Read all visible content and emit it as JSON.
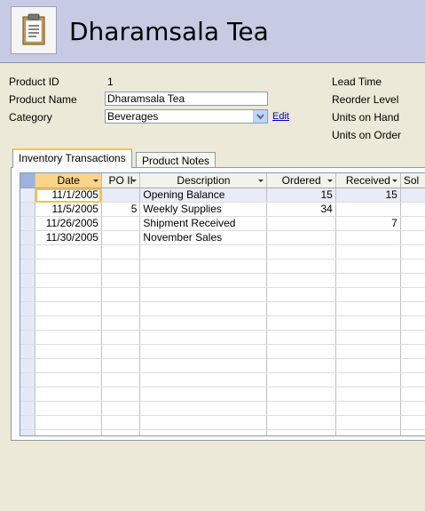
{
  "header": {
    "title": "Dharamsala Tea",
    "icon": "clipboard-icon"
  },
  "fields": {
    "product_id_label": "Product ID",
    "product_id_value": "1",
    "product_name_label": "Product Name",
    "product_name_value": "Dharamsala Tea",
    "category_label": "Category",
    "category_value": "Beverages",
    "edit_link": "Edit",
    "lead_time_label": "Lead Time",
    "reorder_level_label": "Reorder Level",
    "units_on_hand_label": "Units on Hand",
    "units_on_order_label": "Units on Order"
  },
  "tabs": [
    {
      "label": "Inventory Transactions",
      "active": true
    },
    {
      "label": "Product Notes",
      "active": false
    }
  ],
  "grid": {
    "columns": [
      "Date",
      "PO II",
      "Description",
      "Ordered",
      "Received",
      "Sol"
    ],
    "rows": [
      {
        "date": "11/1/2005",
        "po": "",
        "description": "Opening Balance",
        "ordered": "15",
        "received": "15"
      },
      {
        "date": "11/5/2005",
        "po": "5",
        "description": "Weekly Supplies",
        "ordered": "34",
        "received": ""
      },
      {
        "date": "11/26/2005",
        "po": "",
        "description": "Shipment Received",
        "ordered": "",
        "received": "7"
      },
      {
        "date": "11/30/2005",
        "po": "",
        "description": "November Sales",
        "ordered": "",
        "received": ""
      }
    ]
  },
  "colors": {
    "header_bg": "#c6cbe3",
    "active_tab_accent": "#ffc83c",
    "sorted_header": "#fbd38a"
  }
}
